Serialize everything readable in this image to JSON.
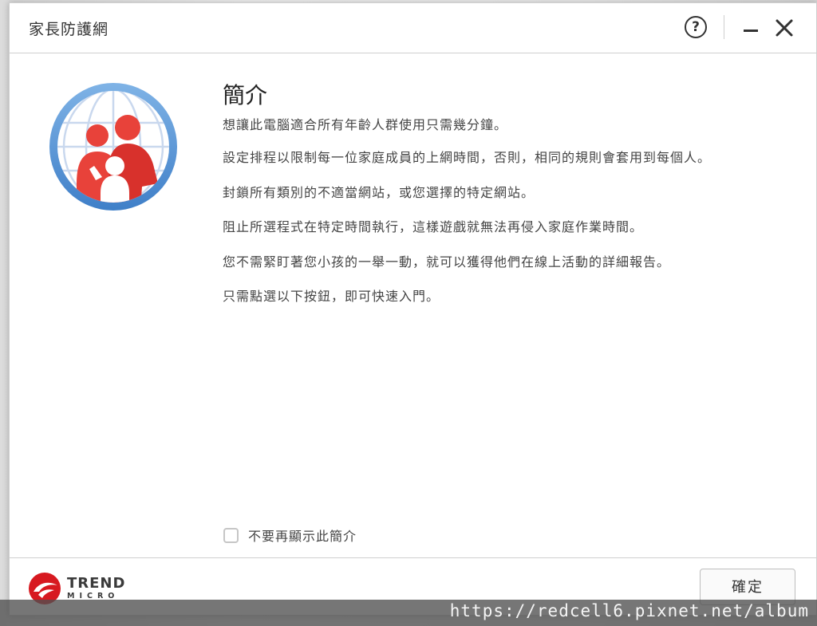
{
  "window": {
    "title": "家長防護網",
    "help_label": "?"
  },
  "main": {
    "heading": "簡介",
    "intro": "想讓此電腦適合所有年齡人群使用只需幾分鐘。",
    "bullets": [
      "設定排程以限制每一位家庭成員的上網時間，否則，相同的規則會套用到每個人。",
      "封鎖所有類別的不適當網站，或您選擇的特定網站。",
      "阻止所選程式在特定時間執行，這樣遊戲就無法再侵入家庭作業時間。",
      "您不需緊盯著您小孩的一舉一動，就可以獲得他們在線上活動的詳細報告。",
      "只需點選以下按鈕，即可快速入門。"
    ],
    "dont_show_label": "不要再顯示此簡介",
    "dont_show_checked": false
  },
  "footer": {
    "brand_line1": "TREND",
    "brand_line2": "MICRO",
    "ok_label": "確定"
  },
  "watermark": "https://redcell6.pixnet.net/album",
  "colors": {
    "brand_red": "#d71920",
    "logo_blue": "#5b9bd5",
    "text": "#444444"
  },
  "icons": [
    "help-icon",
    "minimize-icon",
    "close-icon",
    "family-globe-logo",
    "trend-micro-logo"
  ]
}
